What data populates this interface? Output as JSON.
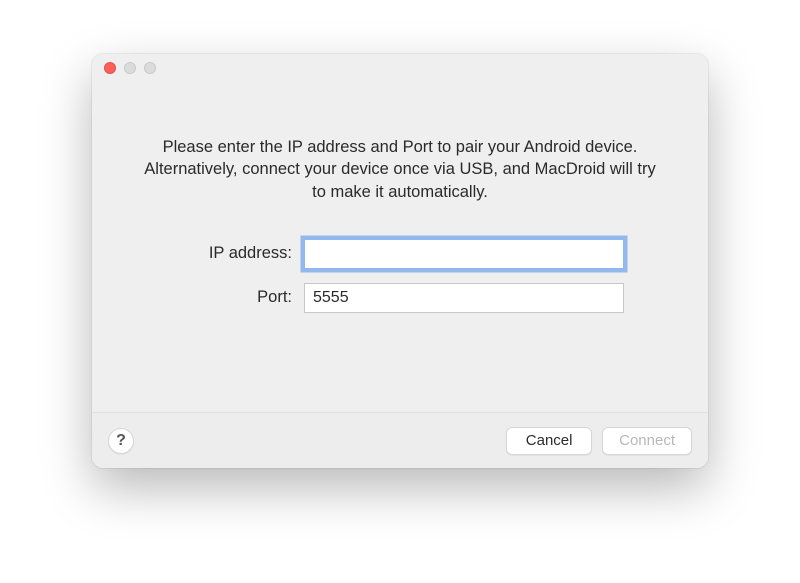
{
  "dialog": {
    "instructions": "Please enter the IP address and Port to pair your Android device. Alternatively, connect your device once via USB, and MacDroid will try to make it automatically.",
    "ip_label": "IP address:",
    "ip_value": "",
    "port_label": "Port:",
    "port_value": "5555"
  },
  "footer": {
    "help_label": "?",
    "cancel_label": "Cancel",
    "connect_label": "Connect"
  }
}
